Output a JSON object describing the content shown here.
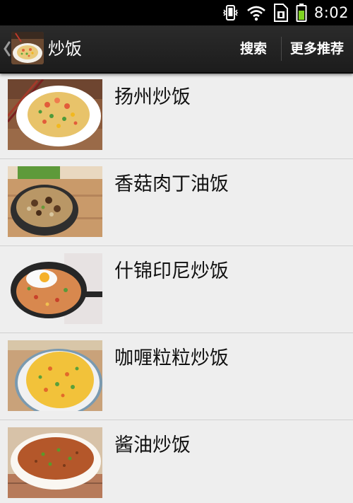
{
  "status_bar": {
    "time": "8:02",
    "icons": [
      "vibrate-icon",
      "wifi-icon",
      "sim-card-icon",
      "battery-icon"
    ]
  },
  "action_bar": {
    "title": "炒饭",
    "search_label": "搜索",
    "more_label": "更多推荐",
    "logo_icon": "fried-rice-logo-icon",
    "up_icon": "chevron-left-icon"
  },
  "recipes": [
    {
      "title": "扬州炒饭"
    },
    {
      "title": "香菇肉丁油饭"
    },
    {
      "title": "什锦印尼炒饭"
    },
    {
      "title": "咖喱粒粒炒饭"
    },
    {
      "title": "酱油炒饭"
    }
  ]
}
